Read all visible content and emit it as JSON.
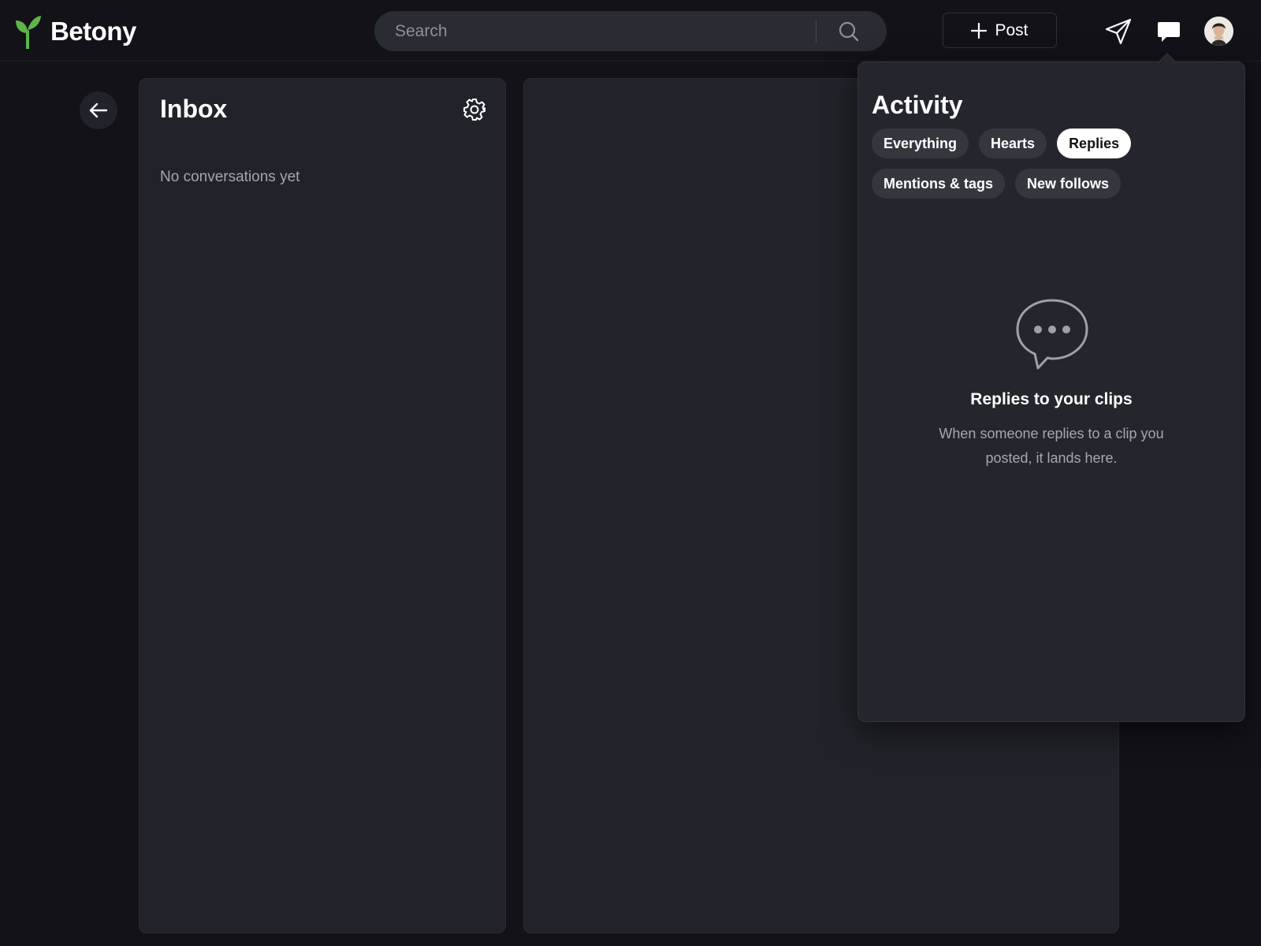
{
  "app": {
    "name": "Betony",
    "brand_color": "#5fb548"
  },
  "header": {
    "search": {
      "placeholder": "Search",
      "icon": "search-icon"
    },
    "post_button": {
      "label": "Post",
      "icon": "plus-icon"
    },
    "icons": [
      "send-icon",
      "chat-bubble-icon",
      "avatar"
    ]
  },
  "back_button": {
    "icon": "arrow-left-icon"
  },
  "inbox": {
    "title": "Inbox",
    "settings_icon": "gear-icon",
    "empty_text": "No conversations yet"
  },
  "activity": {
    "title": "Activity",
    "filters": [
      {
        "label": "Everything",
        "active": false
      },
      {
        "label": "Hearts",
        "active": false
      },
      {
        "label": "Replies",
        "active": true
      },
      {
        "label": "Mentions & tags",
        "active": false
      },
      {
        "label": "New follows",
        "active": false
      }
    ],
    "empty_state": {
      "icon": "speech-bubble-dots-icon",
      "title": "Replies to your clips",
      "description": "When someone replies to a clip you posted, it lands here."
    }
  }
}
